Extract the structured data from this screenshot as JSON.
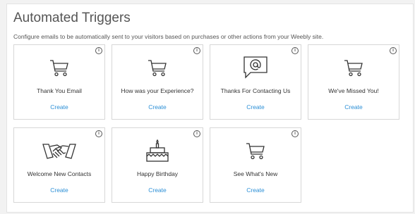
{
  "header": {
    "title": "Automated Triggers",
    "subtitle": "Configure emails to be automatically sent to your visitors based on purchases or other actions from your Weebly site."
  },
  "cards": [
    {
      "label": "Thank You Email",
      "create": "Create",
      "icon": "cart-icon"
    },
    {
      "label": "How was your Experience?",
      "create": "Create",
      "icon": "cart-icon"
    },
    {
      "label": "Thanks For Contacting Us",
      "create": "Create",
      "icon": "at-speech-bubble-icon"
    },
    {
      "label": "We've Missed You!",
      "create": "Create",
      "icon": "cart-icon"
    },
    {
      "label": "Welcome New Contacts",
      "create": "Create",
      "icon": "handshake-icon"
    },
    {
      "label": "Happy Birthday",
      "create": "Create",
      "icon": "birthday-cake-icon"
    },
    {
      "label": "See What's New",
      "create": "Create",
      "icon": "cart-icon"
    }
  ],
  "info_glyph": "i",
  "colors": {
    "link": "#2b8fd6",
    "border": "#d7d7d7",
    "background": "#f2f2f2"
  }
}
